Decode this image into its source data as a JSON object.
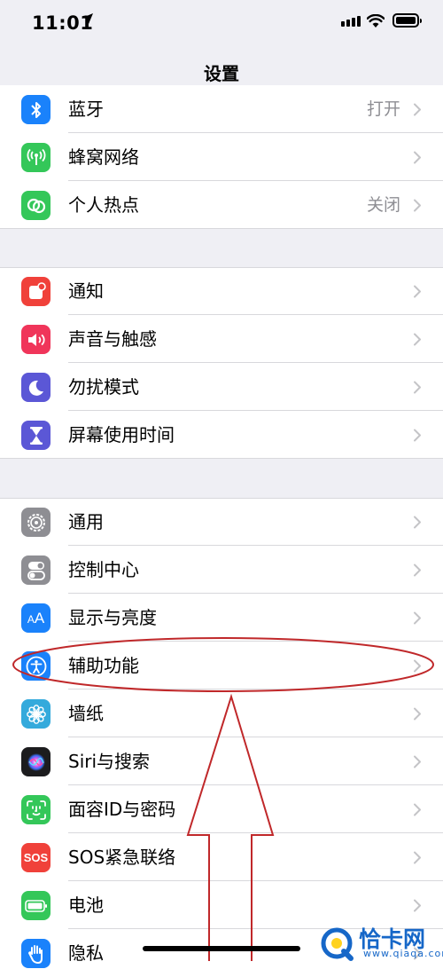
{
  "status_bar": {
    "time": "11:01"
  },
  "nav": {
    "title": "设置"
  },
  "groups": [
    {
      "rows": [
        {
          "label": "蓝牙",
          "value": "打开",
          "icon": "bluetooth-icon",
          "color": "#1a82fb"
        },
        {
          "label": "蜂窝网络",
          "value": "",
          "icon": "cellular-icon",
          "color": "#34c759"
        },
        {
          "label": "个人热点",
          "value": "关闭",
          "icon": "hotspot-icon",
          "color": "#34c759"
        }
      ]
    },
    {
      "rows": [
        {
          "label": "通知",
          "icon": "notifications-icon",
          "color": "#f0413a"
        },
        {
          "label": "声音与触感",
          "icon": "sound-icon",
          "color": "#f0355a"
        },
        {
          "label": "勿扰模式",
          "icon": "moon-icon",
          "color": "#5b57d6"
        },
        {
          "label": "屏幕使用时间",
          "icon": "hourglass-icon",
          "color": "#5b57d6"
        }
      ]
    },
    {
      "rows": [
        {
          "label": "通用",
          "icon": "gear-icon",
          "color": "#8e8e93"
        },
        {
          "label": "控制中心",
          "icon": "toggles-icon",
          "color": "#8e8e93"
        },
        {
          "label": "显示与亮度",
          "icon": "text-size-icon",
          "color": "#1a82fb"
        },
        {
          "label": "辅助功能",
          "icon": "accessibility-icon",
          "color": "#1a82fb"
        },
        {
          "label": "墙纸",
          "icon": "flower-icon",
          "color": "#34aadc"
        },
        {
          "label": "Siri与搜索",
          "icon": "siri-icon",
          "color": "#222222"
        },
        {
          "label": "面容ID与密码",
          "icon": "faceid-icon",
          "color": "#34c759"
        },
        {
          "label": "SOS紧急联络",
          "icon_text": "SOS",
          "icon": "sos-icon",
          "color": "#f0413a"
        },
        {
          "label": "电池",
          "icon": "battery-icon",
          "color": "#34c759"
        },
        {
          "label": "隐私",
          "icon": "hand-icon",
          "color": "#1a82fb"
        }
      ]
    }
  ],
  "annotation": {
    "highlight_color": "#c0282a",
    "highlighted_row": "辅助功能"
  },
  "watermark": {
    "text": "恰卡网",
    "url": "www.qiaqa.com"
  }
}
